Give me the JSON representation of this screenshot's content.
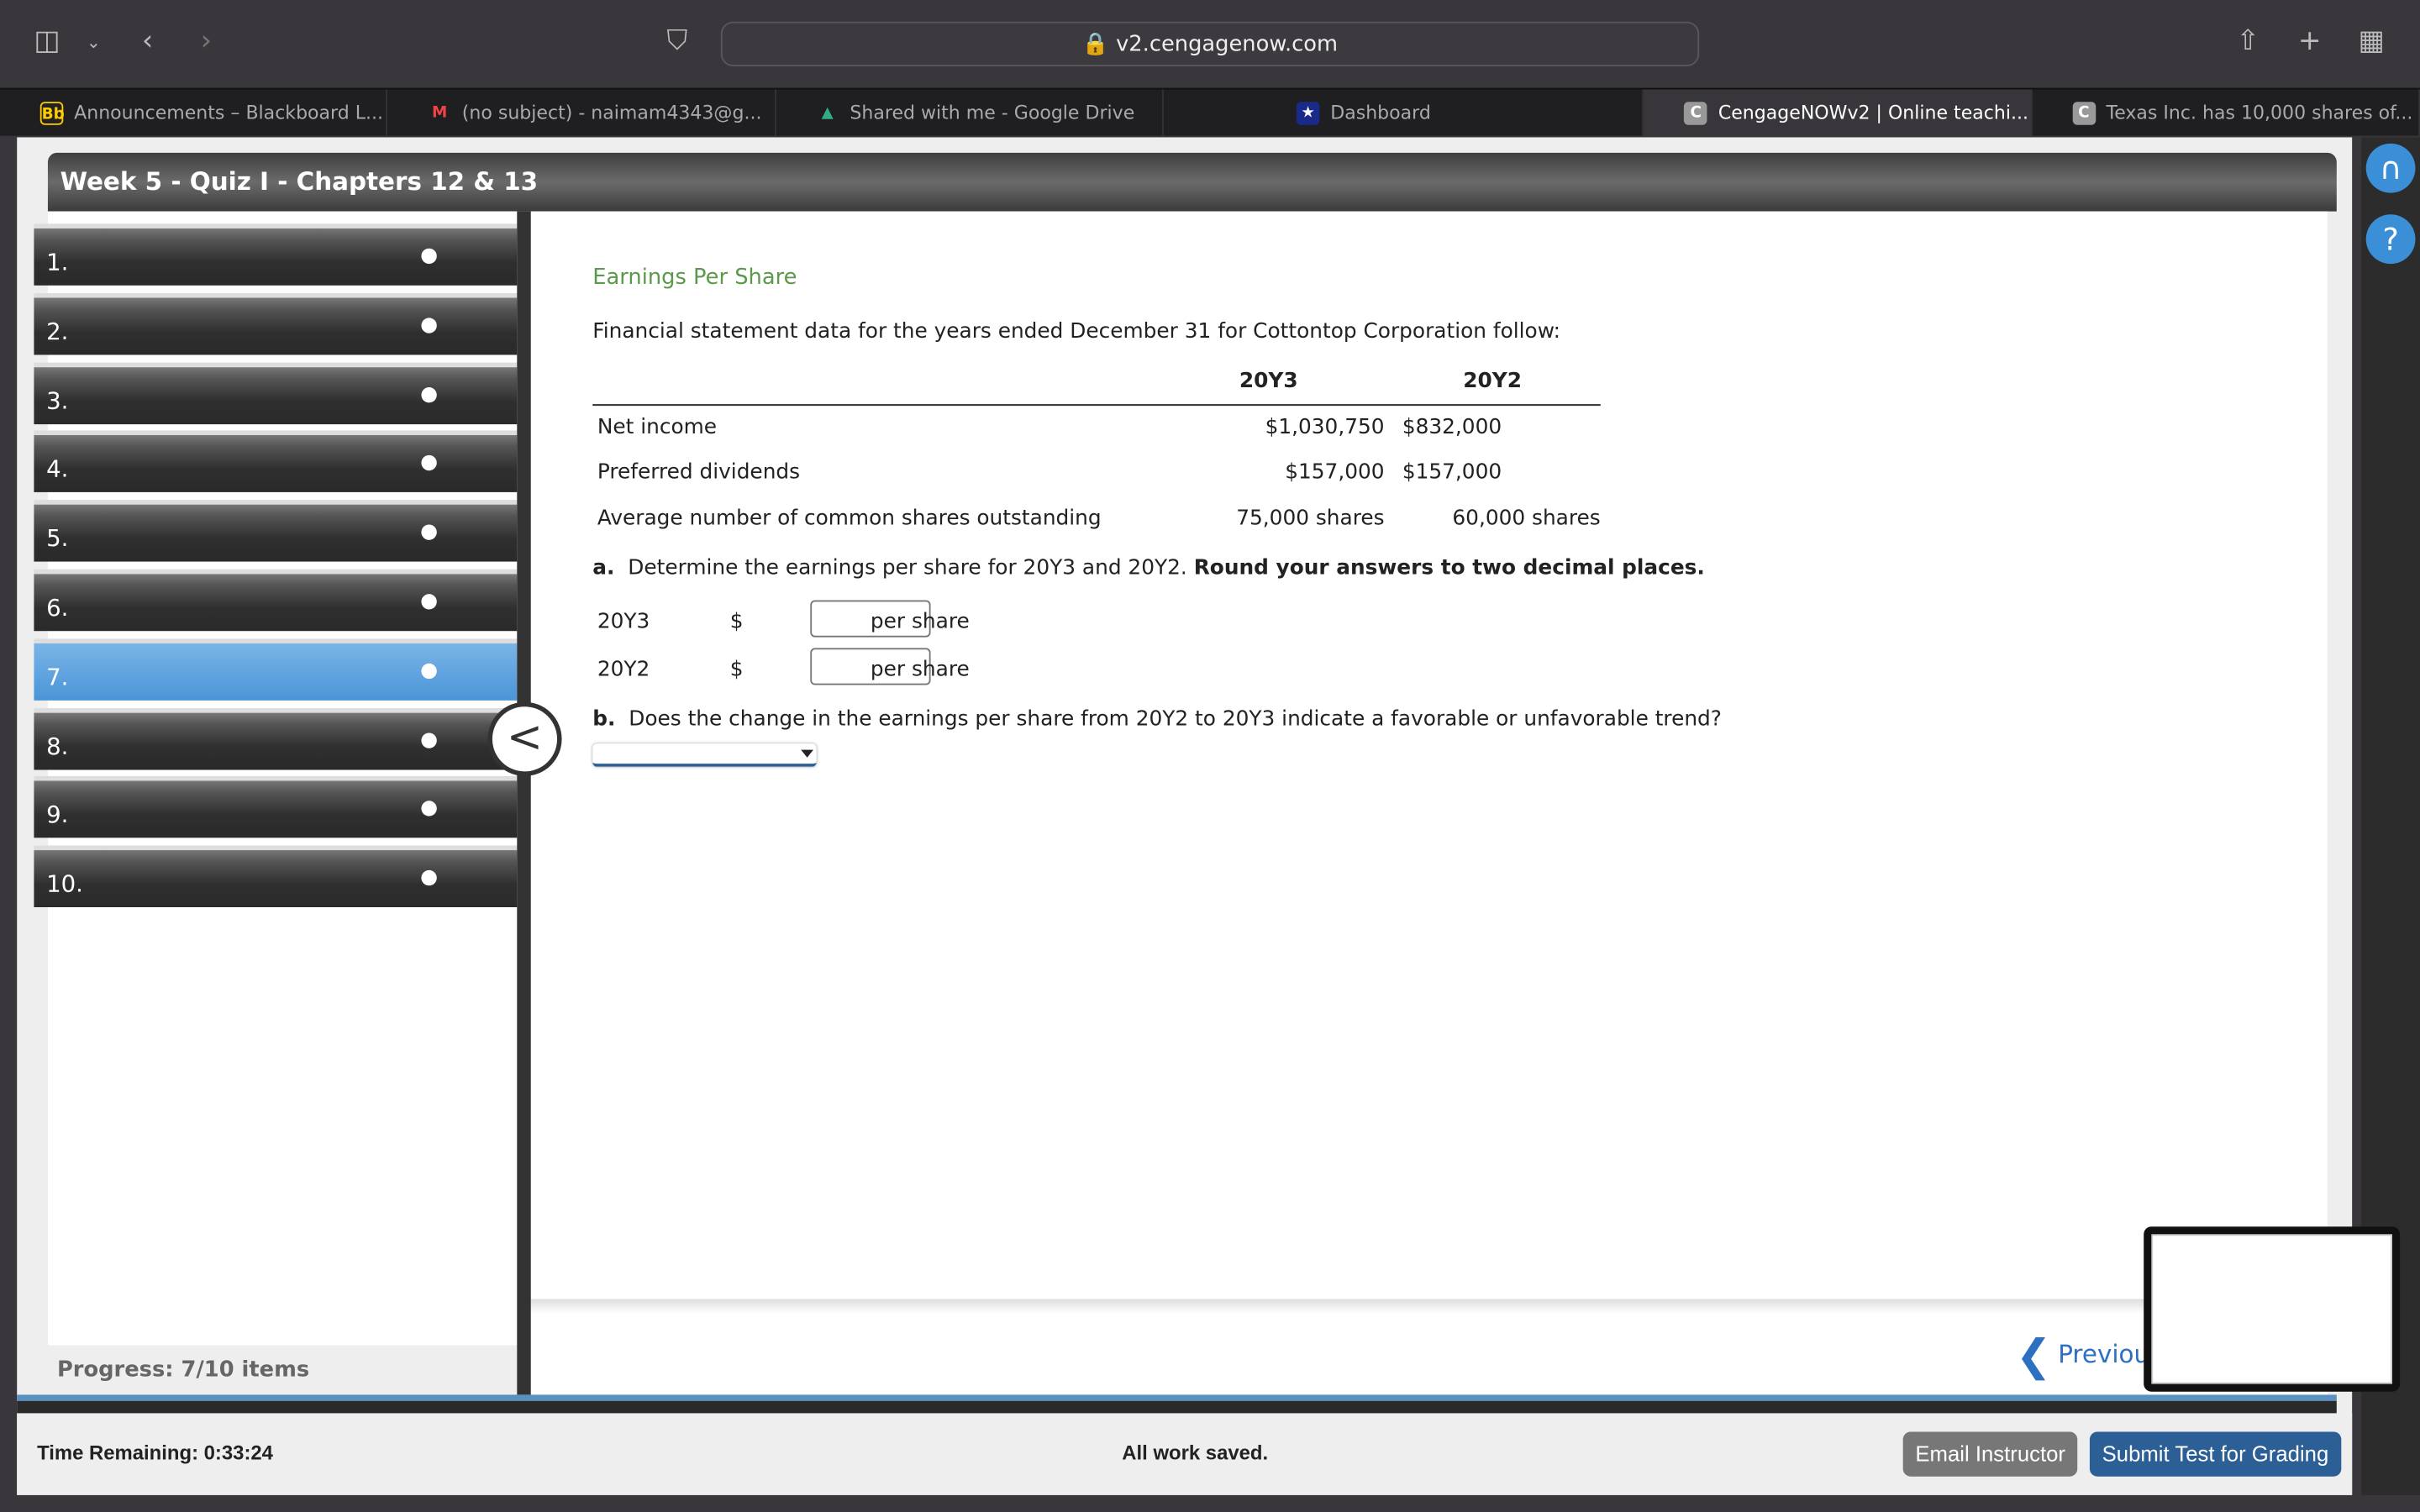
{
  "browser": {
    "url": "v2.cengagenow.com",
    "tabs": [
      {
        "label": "Announcements – Blackboard L...",
        "fav": "Bb"
      },
      {
        "label": "(no subject) - naimam4343@g...",
        "fav": "M"
      },
      {
        "label": "Shared with me - Google Drive",
        "fav": "▲"
      },
      {
        "label": "Dashboard",
        "fav": "★"
      },
      {
        "label": "CengageNOWv2 | Online teachi...",
        "fav": "C"
      },
      {
        "label": "Texas Inc. has 10,000 shares of...",
        "fav": "C"
      }
    ]
  },
  "quiz": {
    "title": "Week 5 - Quiz I - Chapters 12 & 13",
    "questions": [
      "1.",
      "2.",
      "3.",
      "4.",
      "5.",
      "6.",
      "7.",
      "8.",
      "9.",
      "10."
    ],
    "current": 7,
    "progress": "Progress:  7/10 items"
  },
  "problem": {
    "title": "Earnings Per Share",
    "intro": "Financial statement data for the years ended December 31 for Cottontop Corporation follow:",
    "columns": [
      "",
      "20Y3",
      "20Y2"
    ],
    "rows": [
      [
        "Net income",
        "$1,030,750",
        "$832,000"
      ],
      [
        "Preferred dividends",
        "$157,000",
        "$157,000"
      ],
      [
        "Average number of common shares outstanding",
        "75,000  shares",
        "60,000  shares"
      ]
    ],
    "part_a_label": "a.",
    "part_a": "Determine the earnings per share for 20Y3 and 20Y2.",
    "part_a_bold": "Round your answers to two decimal places.",
    "answers": [
      {
        "year": "20Y3",
        "prefix": "$",
        "suffix": "per share",
        "value": ""
      },
      {
        "year": "20Y2",
        "prefix": "$",
        "suffix": "per share",
        "value": ""
      }
    ],
    "part_b_label": "b.",
    "part_b": "Does the change in the earnings per share from 20Y2 to 20Y3 indicate a favorable or unfavorable trend?",
    "part_b_value": ""
  },
  "nav": {
    "previous": "Previous",
    "collapse": "<"
  },
  "footer": {
    "time": "Time Remaining: 0:33:24",
    "saved": "All work saved.",
    "email": "Email Instructor",
    "submit": "Submit Test for Grading"
  },
  "colors": {
    "accent": "#2d5f97",
    "title_green": "#5a9a4a",
    "current_item": "#4a95d8"
  }
}
